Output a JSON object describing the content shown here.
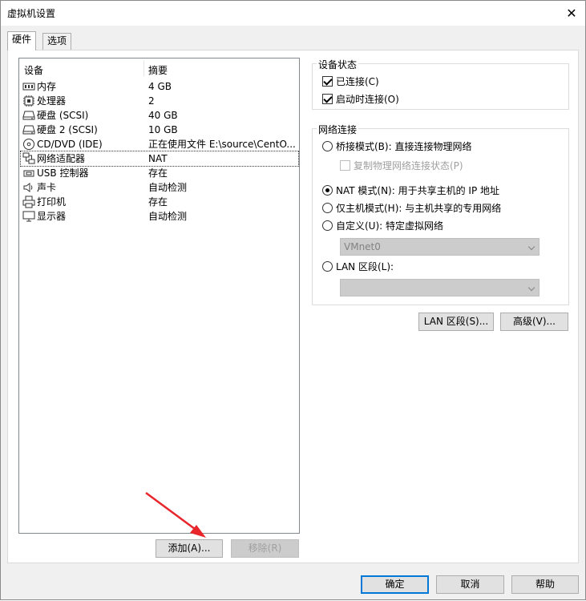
{
  "window": {
    "title": "虚拟机设置"
  },
  "tabs": [
    {
      "label": "硬件",
      "active": true
    },
    {
      "label": "选项",
      "active": false
    }
  ],
  "device_list": {
    "columns": [
      "设备",
      "摘要"
    ],
    "rows": [
      {
        "icon": "memory-icon",
        "name": "内存",
        "summary": "4 GB"
      },
      {
        "icon": "cpu-icon",
        "name": "处理器",
        "summary": "2"
      },
      {
        "icon": "disk-icon",
        "name": "硬盘 (SCSI)",
        "summary": "40 GB"
      },
      {
        "icon": "disk-icon",
        "name": "硬盘 2 (SCSI)",
        "summary": "10 GB"
      },
      {
        "icon": "cd-icon",
        "name": "CD/DVD (IDE)",
        "summary": "正在使用文件 E:\\source\\CentO..."
      },
      {
        "icon": "network-icon",
        "name": "网络适配器",
        "summary": "NAT",
        "selected": true
      },
      {
        "icon": "usb-icon",
        "name": "USB 控制器",
        "summary": "存在"
      },
      {
        "icon": "speaker-icon",
        "name": "声卡",
        "summary": "自动检测"
      },
      {
        "icon": "printer-icon",
        "name": "打印机",
        "summary": "存在"
      },
      {
        "icon": "monitor-icon",
        "name": "显示器",
        "summary": "自动检测"
      }
    ]
  },
  "list_buttons": {
    "add": "添加(A)...",
    "remove": "移除(R)"
  },
  "device_status": {
    "label": "设备状态",
    "connected": {
      "label": "已连接(C)",
      "checked": true
    },
    "connect_at_power_on": {
      "label": "启动时连接(O)",
      "checked": true
    }
  },
  "network": {
    "label": "网络连接",
    "bridged": {
      "label": "桥接模式(B): 直接连接物理网络",
      "checked": false
    },
    "replicate": {
      "label": "复制物理网络连接状态(P)",
      "checked": false
    },
    "nat": {
      "label": "NAT 模式(N): 用于共享主机的 IP 地址",
      "checked": true
    },
    "hostonly": {
      "label": "仅主机模式(H): 与主机共享的专用网络",
      "checked": false
    },
    "custom": {
      "label": "自定义(U): 特定虚拟网络",
      "checked": false
    },
    "custom_value": "VMnet0",
    "lan": {
      "label": "LAN 区段(L):",
      "checked": false
    },
    "lan_value": ""
  },
  "side_buttons": {
    "lan_segments": "LAN 区段(S)...",
    "advanced": "高级(V)..."
  },
  "footer": {
    "ok": "确定",
    "cancel": "取消",
    "help": "帮助"
  },
  "colors": {
    "accent": "#0078d7",
    "annotation_arrow": "#e8262b"
  }
}
